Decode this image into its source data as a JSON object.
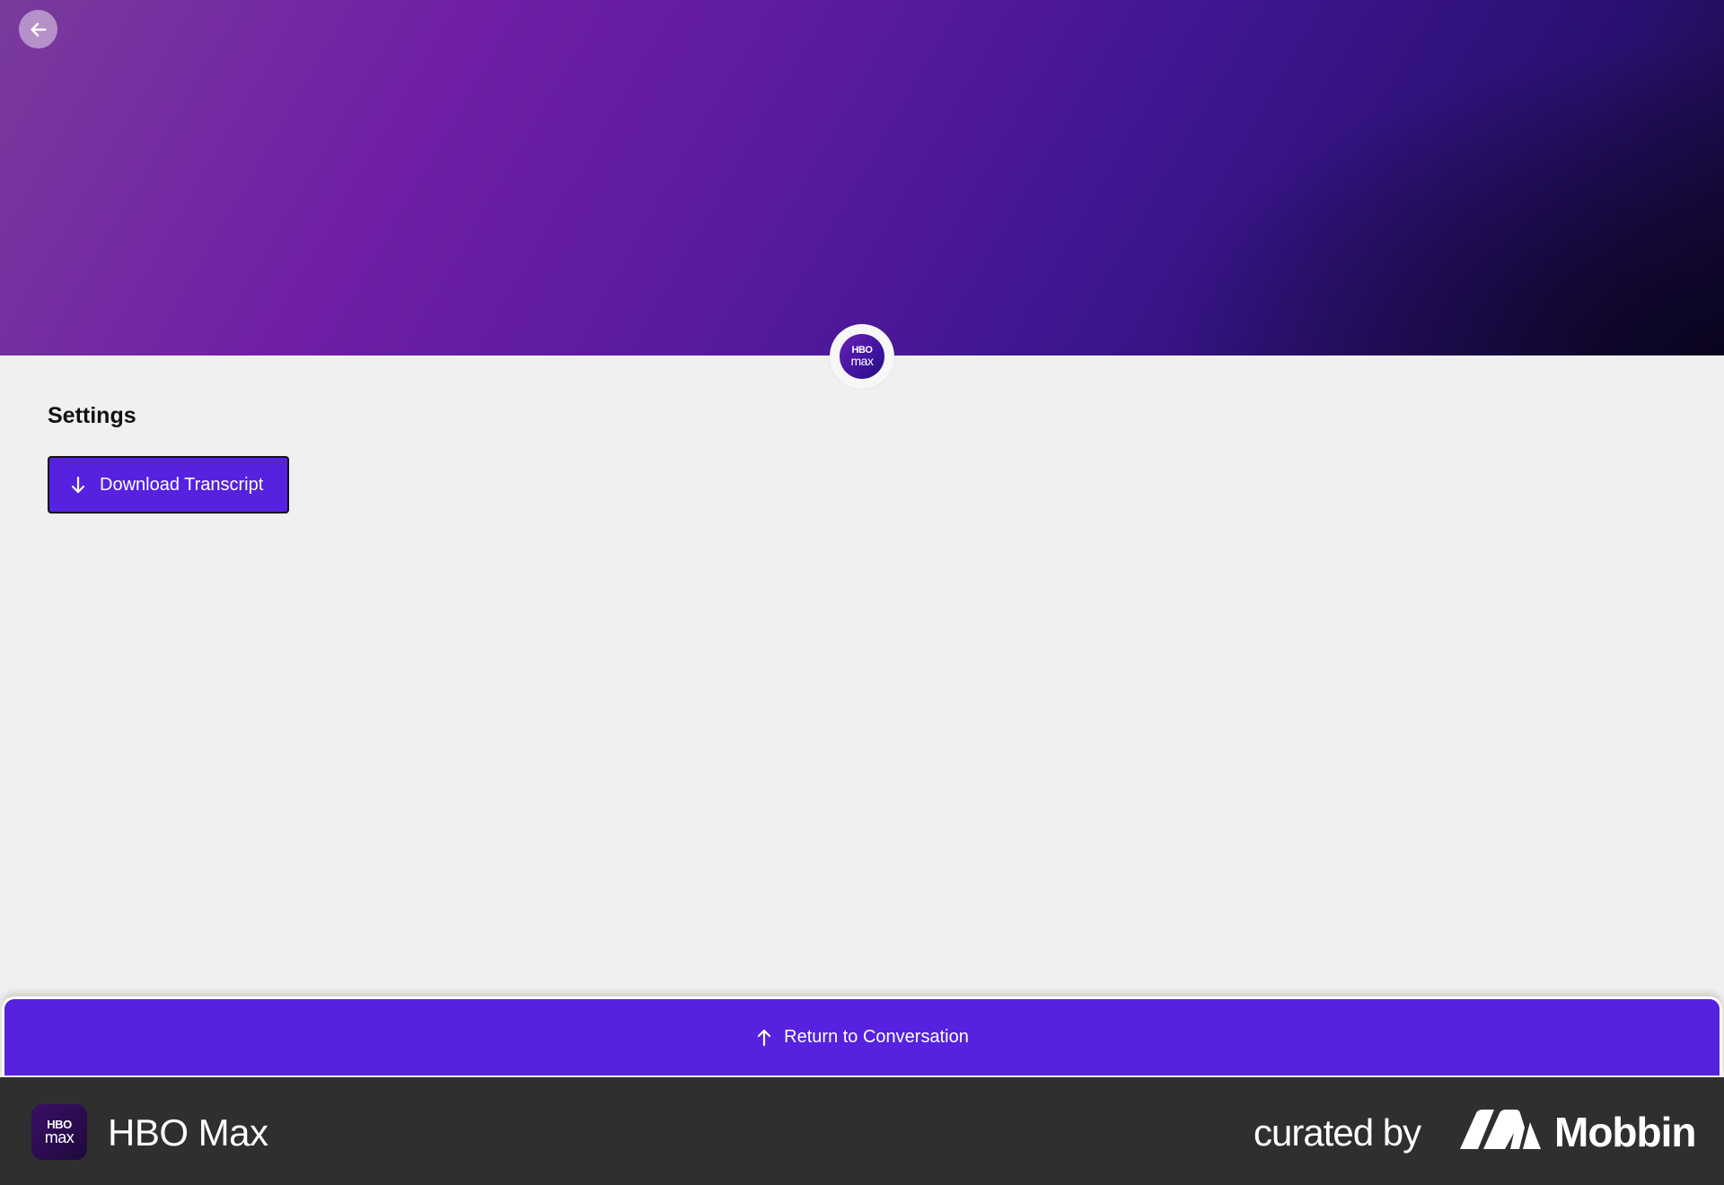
{
  "hero": {
    "logo_top": "HBO",
    "logo_bottom": "max"
  },
  "settings": {
    "title": "Settings",
    "download_label": "Download Transcript"
  },
  "return_bar": {
    "label": "Return to Conversation"
  },
  "footer": {
    "app_icon_top": "HBO",
    "app_icon_bottom": "max",
    "app_name": "HBO Max",
    "curated_label": "curated by",
    "brand_name": "Mobbin"
  },
  "colors": {
    "accent": "#5621df",
    "footer_bg": "#2f2f2f",
    "page_bg": "#f0f0f0"
  },
  "icons": {
    "back": "arrow-left-icon",
    "download": "arrow-down-icon",
    "return": "arrow-up-icon"
  }
}
